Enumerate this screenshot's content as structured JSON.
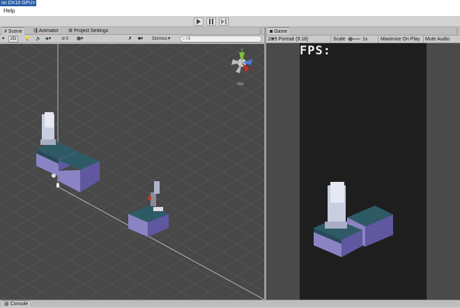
{
  "titlebar": {
    "selected_text": "on DX10 GPU>"
  },
  "menu": {
    "help": "Help"
  },
  "scene_panel": {
    "tabs": [
      {
        "label": "Scene",
        "icon": "grid-icon"
      },
      {
        "label": "Animator",
        "icon": "animator-icon"
      },
      {
        "label": "Project Settings",
        "icon": "gear-icon"
      }
    ],
    "toolbar": {
      "mode_2d": "2D",
      "hidden_count": "0",
      "gizmos": "Gizmos",
      "search_placeholder": "All"
    },
    "iso_label": "Iso"
  },
  "game_panel": {
    "tab": {
      "label": "Game",
      "icon": "gamepad-icon"
    },
    "aspect": "18:9 Portrait (9:18)",
    "scale_label": "Scale",
    "scale_value": "1x",
    "maximize": "Maximize On Play",
    "mute": "Mute Audio",
    "fps_label": "FPS:"
  },
  "console": {
    "tab": "Console"
  },
  "colors": {
    "scene_bg": "#484848",
    "game_bg": "#1e1e1e",
    "tile_top": "#2e5a66",
    "tile_side": "#8a83c4"
  }
}
